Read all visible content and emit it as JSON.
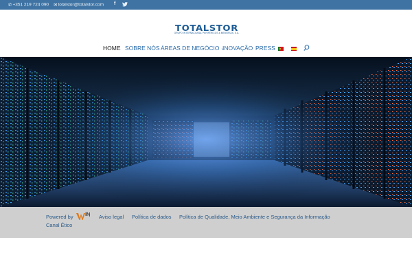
{
  "topbar": {
    "phone": "+351 219 724 090",
    "email": "totalstor@totalstor.com",
    "social": [
      "facebook-icon",
      "twitter-icon"
    ]
  },
  "header": {
    "logo_text": "TOTALSTOR",
    "logo_subtitle": "GRUPO INTERNACIONAL PERIFÉRICOS & MEMÓRIAS, S.A."
  },
  "nav": {
    "items": [
      {
        "label": "HOME",
        "active": true
      },
      {
        "label": "SOBRE NÓS"
      },
      {
        "label": "ÁREAS DE NEGÓCIO",
        "has_dropdown": true
      },
      {
        "label": "INOVAÇÃO"
      },
      {
        "label": "PRESS"
      }
    ],
    "languages": [
      "portugal-flag-icon",
      "spain-flag-icon"
    ],
    "search_icon": "search-icon"
  },
  "hero": {
    "image": "data-center-server-racks"
  },
  "footer": {
    "powered_by": "Powered by",
    "links": [
      "Aviso legal",
      "Política de dados",
      "Política de Qualidade, Meio Ambiente e Segurança da Informação",
      "Canal Ético"
    ]
  },
  "colors": {
    "topbar": "#3e73a3",
    "brand": "#1d5c96",
    "nav_link": "#2a6aa8",
    "footer_bg": "#cfcfcf"
  }
}
